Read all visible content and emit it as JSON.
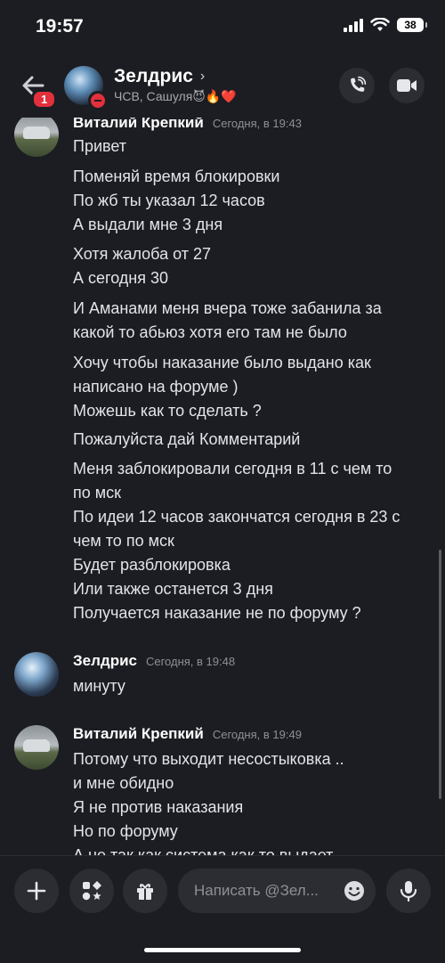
{
  "status_bar": {
    "time": "19:57",
    "battery": "38"
  },
  "header": {
    "back_badge": "1",
    "title": "Зелдрис",
    "subtitle": "ЧСВ, Сашуля😈🔥❤️"
  },
  "messages": [
    {
      "author": "Виталий Крепкий",
      "timestamp": "Сегодня, в 19:43",
      "lines": [
        "Привет",
        "Поменяй время блокировки",
        "По жб ты указал 12 часов",
        "А выдали мне 3 дня",
        "Хотя жалоба от 27",
        "А сегодня 30",
        "И Аманами меня вчера тоже забанила за",
        "какой то абьюз хотя его там не было",
        "Хочу чтобы наказание было выдано как",
        "написано на форуме )",
        "Можешь как то сделать ?",
        "Пожалуйста дай Комментарий",
        "Меня заблокировали сегодня в 11 с чем то",
        "по мск",
        "По идеи 12 часов закончатся сегодня в 23 с",
        "чем то по мск",
        "Будет разблокировка",
        "Или также останется 3 дня",
        "Получается наказание не по форуму ?"
      ]
    },
    {
      "author": "Зелдрис",
      "timestamp": "Сегодня, в 19:48",
      "lines": [
        "минуту"
      ]
    },
    {
      "author": "Виталий Крепкий",
      "timestamp": "Сегодня, в 19:49",
      "lines": [
        "Потому что выходит несостыковка ..",
        "и мне обидно",
        "Я не против наказания",
        "Но по форуму",
        "А не так как система как то выдает"
      ]
    }
  ],
  "composer": {
    "placeholder": "Написать @Зел..."
  },
  "icons": {
    "back": "arrow-left-icon",
    "call": "phone-call-icon",
    "video": "video-camera-icon",
    "add": "plus-icon",
    "apps": "apps-icon",
    "gift": "gift-icon",
    "emoji": "emoji-icon",
    "mic": "microphone-icon"
  }
}
